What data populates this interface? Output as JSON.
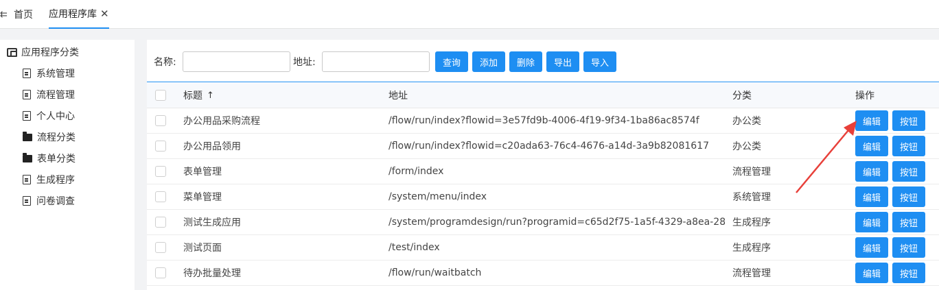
{
  "tabs": {
    "home_label": "首页",
    "library_label": "应用程序库",
    "close_glyph": "✕"
  },
  "sidebar": {
    "root_label": "应用程序分类",
    "items": [
      {
        "label": "系统管理",
        "icon": "document-icon"
      },
      {
        "label": "流程管理",
        "icon": "document-icon"
      },
      {
        "label": "个人中心",
        "icon": "document-icon"
      },
      {
        "label": "流程分类",
        "icon": "folder-icon"
      },
      {
        "label": "表单分类",
        "icon": "folder-icon"
      },
      {
        "label": "生成程序",
        "icon": "document-icon"
      },
      {
        "label": "问卷调查",
        "icon": "document-icon"
      }
    ]
  },
  "search": {
    "name_label": "名称:",
    "name_value": "",
    "address_label": "地址:",
    "address_value": "",
    "buttons": [
      "查询",
      "添加",
      "删除",
      "导出",
      "导入"
    ]
  },
  "table": {
    "columns": {
      "title": "标题",
      "address": "地址",
      "category": "分类",
      "operations": "操作"
    },
    "sort_glyph": "↑",
    "edit_label": "编辑",
    "button_label": "按钮",
    "rows": [
      {
        "title": "办公用品采购流程",
        "address": "/flow/run/index?flowid=3e57fd9b-4006-4f19-9f34-1ba86ac8574f",
        "category": "办公类"
      },
      {
        "title": "办公用品领用",
        "address": "/flow/run/index?flowid=c20ada63-76c4-4676-a14d-3a9b82081617",
        "category": "办公类"
      },
      {
        "title": "表单管理",
        "address": "/form/index",
        "category": "流程管理"
      },
      {
        "title": "菜单管理",
        "address": "/system/menu/index",
        "category": "系统管理"
      },
      {
        "title": "测试生成应用",
        "address": "/system/programdesign/run?programid=c65d2f75-1a5f-4329-a8ea-28...",
        "category": "生成程序"
      },
      {
        "title": "测试页面",
        "address": "/test/index",
        "category": "生成程序"
      },
      {
        "title": "待办批量处理",
        "address": "/flow/run/waitbatch",
        "category": "流程管理"
      }
    ]
  },
  "colors": {
    "accent": "#1e8ef2",
    "annotation_arrow": "#e8403a"
  }
}
